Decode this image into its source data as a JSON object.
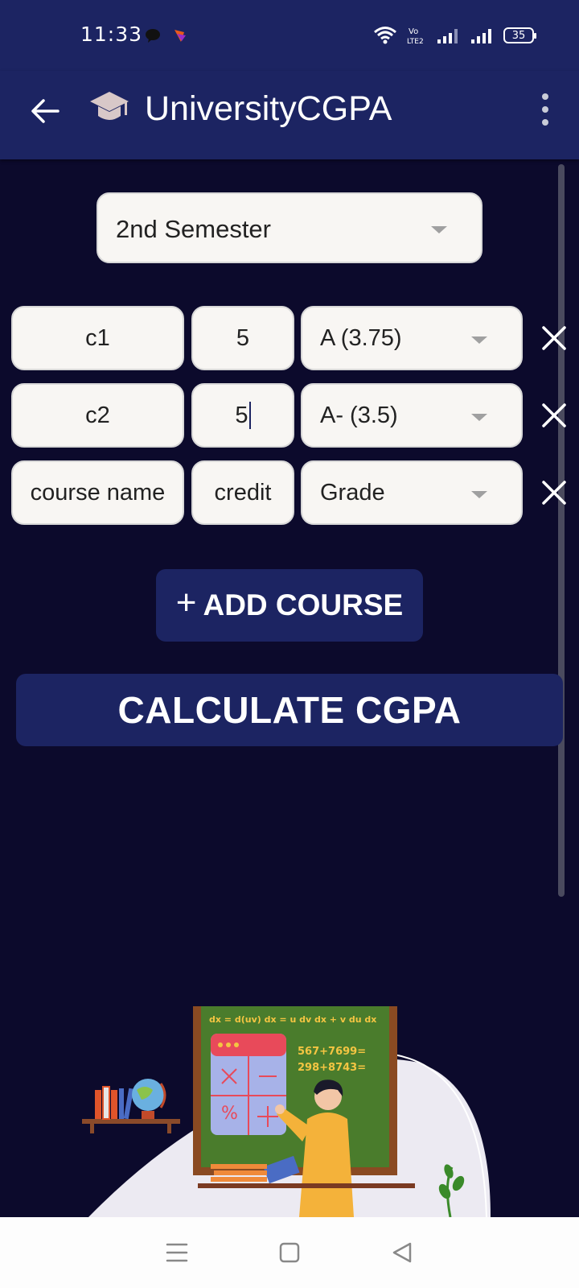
{
  "status": {
    "time": "11:33",
    "battery": "35"
  },
  "app": {
    "title": "UniversityCGPA"
  },
  "semester": {
    "selected": "2nd Semester"
  },
  "courses": [
    {
      "name": "c1",
      "credit": "5",
      "grade": "A (3.75)"
    },
    {
      "name": "c2",
      "credit": "5",
      "grade": "A- (3.5)"
    },
    {
      "name": "course name",
      "credit": "credit",
      "grade": "Grade"
    }
  ],
  "buttons": {
    "add_plus": "+",
    "add_label": "ADD COURSE",
    "calculate": "CALCULATE CGPA"
  },
  "illustration": {
    "equation": "dx = d(uv) dx = u dv dx + v du dx",
    "sum1": "567+7699=",
    "sum2": "298+8743="
  },
  "colors": {
    "background": "#0c0a2c",
    "bar": "#1c2462",
    "field": "#f8f6f3",
    "board": "#4a7c2c",
    "board_text": "#f4c542"
  }
}
